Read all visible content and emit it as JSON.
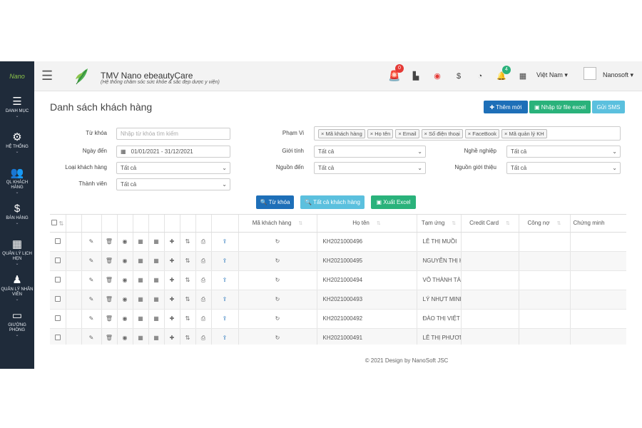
{
  "sidebar": {
    "logo_text": "Nano",
    "items": [
      {
        "icon": "list-icon",
        "glyph": "☰",
        "label": "DANH MỤC"
      },
      {
        "icon": "gear-icon",
        "glyph": "⚙",
        "label": "HỆ THỐNG"
      },
      {
        "icon": "users-icon",
        "glyph": "👥",
        "label": "QL KHÁCH HÀNG"
      },
      {
        "icon": "dollar-icon",
        "glyph": "$",
        "label": "BÁN HÀNG"
      },
      {
        "icon": "calendar-icon",
        "glyph": "▦",
        "label": "QUẢN LÝ LỊCH HẸN"
      },
      {
        "icon": "staff-icon",
        "glyph": "♟",
        "label": "QUẢN LÝ NHÂN VIÊN"
      },
      {
        "icon": "laptop-icon",
        "glyph": "▭",
        "label": "GIƯỜNG PHÒNG"
      }
    ]
  },
  "topbar": {
    "title": "TMV Nano ebeautyCare",
    "subtitle": "(Hệ thống chăm sóc sức khỏe & sắc đẹp dược y viện)",
    "alarm_badge": "0",
    "bell_badge": "4",
    "language": "Việt Nam ▾",
    "user": "Nanosoft ▾",
    "alarm_color": "#e53935",
    "bell_badge_color": "#2ab27b"
  },
  "page": {
    "title": "Danh sách khách hàng",
    "btn_add": "✚ Thêm mới",
    "btn_import": "▣ Nhập từ file excel",
    "btn_sms": "Gửi SMS"
  },
  "filters": {
    "keyword_label": "Từ khóa",
    "keyword_placeholder": "Nhập từ khóa tìm kiếm",
    "scope_label": "Phạm Vi",
    "scope_tags": [
      "× Mã khách hàng",
      "× Họ tên",
      "× Email",
      "× Số điện thoại",
      "× FaceBook",
      "× Mã quản lý KH"
    ],
    "date_label": "Ngày đến",
    "date_value": "01/01/2021 - 31/12/2021",
    "gender_label": "Giới tính",
    "gender_value": "Tất cả",
    "job_label": "Nghề nghiệp",
    "job_value": "Tất cả",
    "type_label": "Loại khách hàng",
    "type_value": "Tất cả",
    "source_label": "Nguồn đến",
    "source_value": "Tất cả",
    "referral_label": "Nguồn giới thiệu",
    "referral_value": "Tất cả",
    "member_label": "Thành viên",
    "member_value": "Tất cả"
  },
  "actions": {
    "search": "🔍 Từ khóa",
    "all": "🔍 Tất cả khách hàng",
    "export": "▣ Xuất Excel"
  },
  "table": {
    "headers": [
      "Mã khách hàng",
      "Họ tên",
      "Tạm ứng",
      "Credit Card",
      "Công nợ",
      "Chứng minh"
    ],
    "rows": [
      {
        "code": "KH2021000496",
        "name": "LÊ THỊ MUỒI",
        "extra": "/"
      },
      {
        "code": "KH2021000495",
        "name": "NGUYỄN THỊ HIỀN NHIÊN",
        "extra": "/"
      },
      {
        "code": "KH2021000494",
        "name": "VÕ THÀNH TÀI",
        "extra": "/"
      },
      {
        "code": "KH2021000493",
        "name": "LÝ NHỰT MINH",
        "extra": "/"
      },
      {
        "code": "KH2021000492",
        "name": "ĐÀO THỊ VIỆT THỦY",
        "extra": "/"
      },
      {
        "code": "KH2021000491",
        "name": "LÊ THỊ PHƯƠNG THỦY",
        "extra": "/"
      }
    ]
  },
  "footer": "© 2021 Design by NanoSoft JSC"
}
